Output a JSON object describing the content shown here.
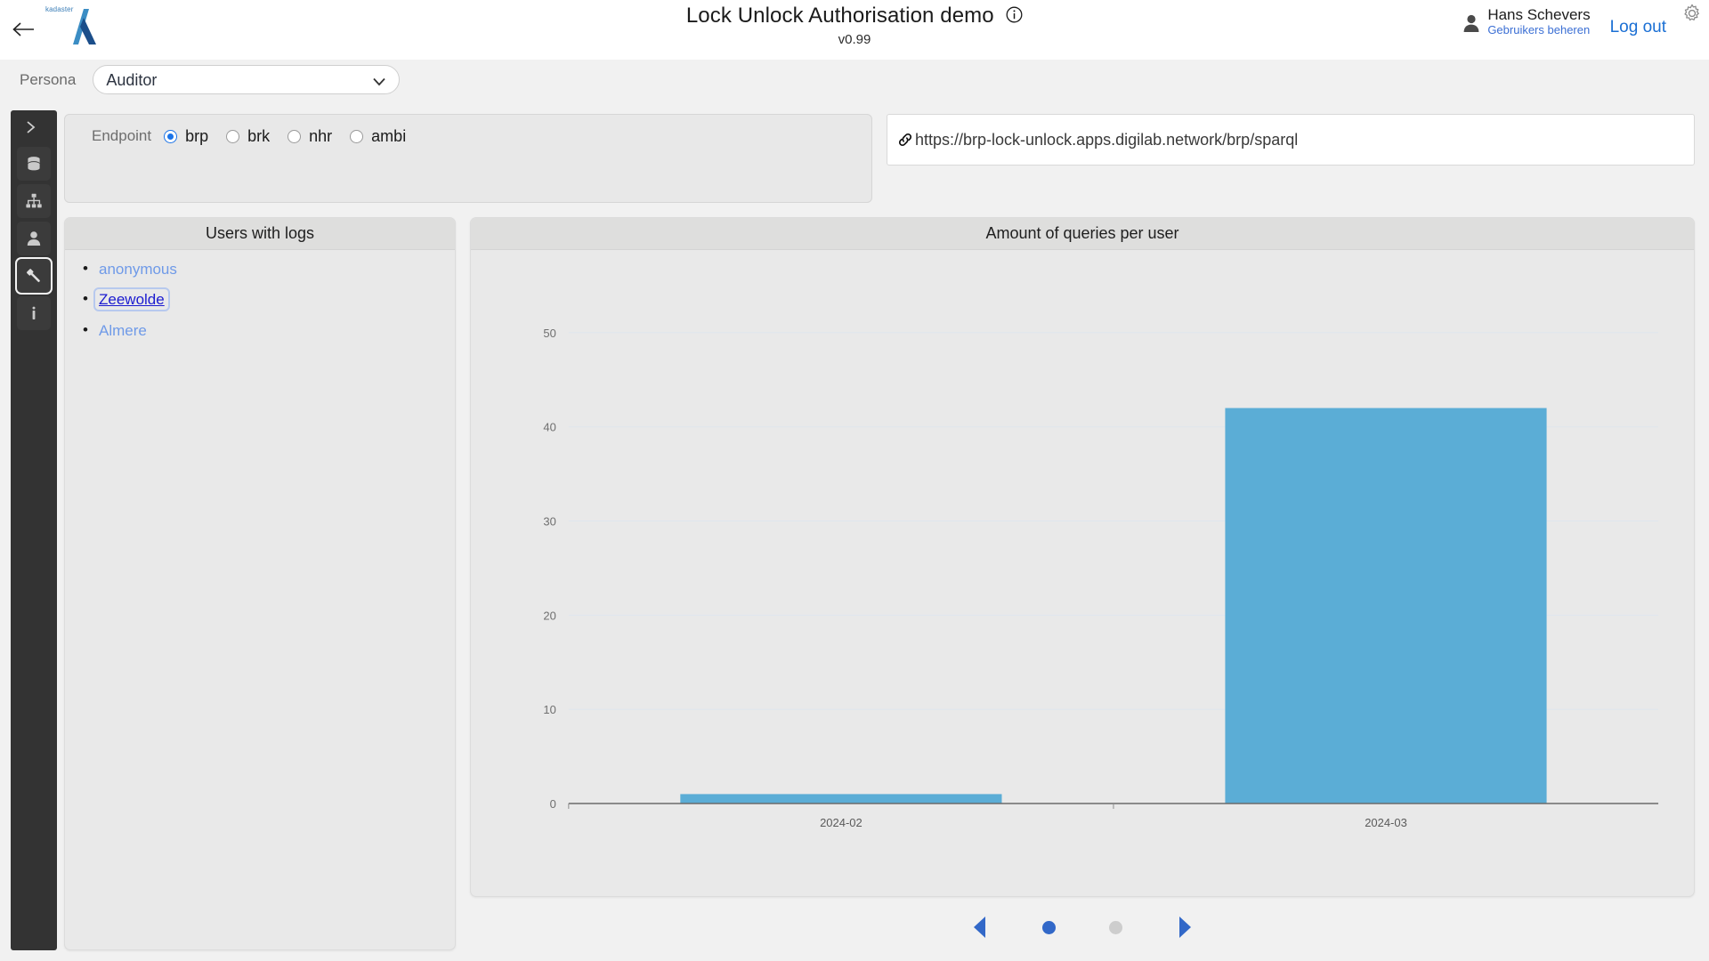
{
  "header": {
    "back_icon": "arrow-left-icon",
    "logo_text": "kadaster",
    "title": "Lock Unlock Authorisation demo",
    "info_icon": "info-circle-icon",
    "version": "v0.99",
    "user_icon": "person-icon",
    "user_name": "Hans Schevers",
    "user_manage_link": "Gebruikers beheren",
    "logout_label": "Log out",
    "settings_icon": "gear-icon"
  },
  "persona": {
    "label": "Persona",
    "selected": "Auditor",
    "options": [
      "Auditor"
    ],
    "chevron_icon": "chevron-down-icon"
  },
  "sidebar": {
    "expand_icon": "chevron-right-icon",
    "items": [
      {
        "name": "database-icon",
        "label": "database"
      },
      {
        "name": "sitemap-icon",
        "label": "hierarchy"
      },
      {
        "name": "person-icon",
        "label": "user"
      },
      {
        "name": "gavel-icon",
        "label": "authorisation",
        "active": true
      },
      {
        "name": "info-icon",
        "label": "info"
      }
    ]
  },
  "endpoint": {
    "label": "Endpoint",
    "options": [
      {
        "value": "brp",
        "checked": true
      },
      {
        "value": "brk",
        "checked": false
      },
      {
        "value": "nhr",
        "checked": false
      },
      {
        "value": "ambi",
        "checked": false
      }
    ]
  },
  "url_bar": {
    "icon": "link-icon",
    "url": "https://brp-lock-unlock.apps.digilab.network/brp/sparql"
  },
  "users_panel": {
    "title": "Users with logs",
    "users": [
      {
        "name": "anonymous",
        "selected": false
      },
      {
        "name": "Zeewolde",
        "selected": true
      },
      {
        "name": "Almere",
        "selected": false
      }
    ]
  },
  "chart_panel": {
    "title": "Amount of queries per user"
  },
  "chart_data": {
    "type": "bar",
    "title": "Amount of queries per user",
    "categories": [
      "2024-02",
      "2024-03"
    ],
    "values": [
      1,
      42
    ],
    "series": [
      {
        "name": "queries",
        "values": [
          1,
          42
        ]
      }
    ],
    "xlabel": "",
    "ylabel": "",
    "ylim": [
      0,
      55
    ],
    "yticks": [
      0,
      10,
      20,
      30,
      40,
      50
    ],
    "ytick_labels": [
      "0",
      "10",
      "20",
      "30",
      "40",
      "50"
    ],
    "grid": true,
    "legend": "none",
    "bar_color": "#5BADD6"
  },
  "pagination": {
    "prev_icon": "triangle-left-icon",
    "next_icon": "triangle-right-icon",
    "dots": [
      {
        "active": true
      },
      {
        "active": false
      }
    ]
  },
  "colors": {
    "accent_blue": "#1a6fd4",
    "bar_blue": "#5BADD6",
    "sidebar_dark": "#333333",
    "panel_bg": "#e9e9e9",
    "panel_head": "#dededd"
  }
}
